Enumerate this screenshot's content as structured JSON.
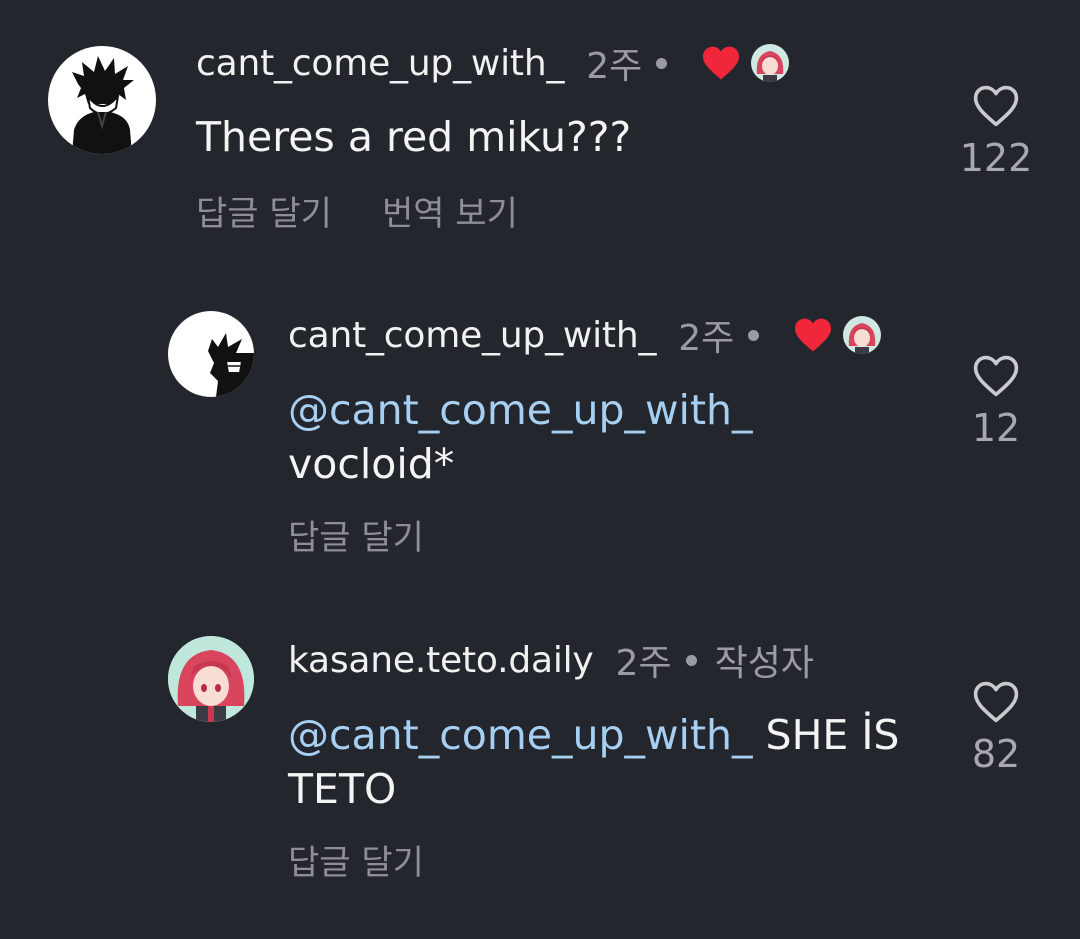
{
  "comments": [
    {
      "username": "cant_come_up_with_",
      "time": "2주",
      "creator_liked": true,
      "text": "Theres a red miku???",
      "reply_label": "답글 달기",
      "translate_label": "번역 보기",
      "like_count": "122"
    },
    {
      "username": "cant_come_up_with_",
      "time": "2주",
      "creator_liked": true,
      "mention": "@cant_come_up_with_",
      "text": "vocloid*",
      "reply_label": "답글 달기",
      "like_count": "12"
    },
    {
      "username": "kasane.teto.daily",
      "time": "2주",
      "author_tag": "작성자",
      "mention": "@cant_come_up_with_",
      "text_line1": " SHE İS",
      "text_line2": "TETO",
      "reply_label": "답글 달기",
      "like_count": "82"
    }
  ],
  "colors": {
    "background": "#24262d",
    "mention": "#a6cff2",
    "liked_heart": "#f0263a",
    "muted": "#8e8f95"
  }
}
